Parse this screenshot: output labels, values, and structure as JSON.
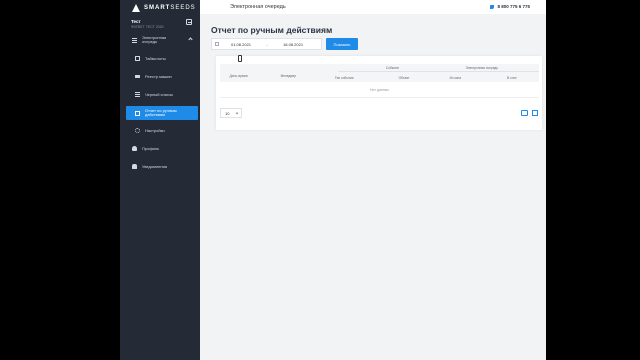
{
  "app": {
    "logo_text_bold": "SMART",
    "logo_text_light": "SEEDS"
  },
  "user": {
    "name": "Тест",
    "org": "ФХПВГТ ТЕСТ 2020"
  },
  "sidebar": {
    "items": [
      {
        "label": "Электронная очередь",
        "icon": "queue-icon"
      },
      {
        "label": "Таймслоты",
        "icon": "timeslot-icon"
      },
      {
        "label": "Реестр машин",
        "icon": "truck-icon"
      },
      {
        "label": "Черный список",
        "icon": "blacklist-icon"
      },
      {
        "label": "Отчет по ручным действиям",
        "icon": "report-icon"
      },
      {
        "label": "Настройки",
        "icon": "gear-icon"
      },
      {
        "label": "Профиль",
        "icon": "user-icon"
      },
      {
        "label": "Уведомления",
        "icon": "bell-icon"
      }
    ]
  },
  "header": {
    "title": "Электронная очередь",
    "phone": "8 800 775 6 775"
  },
  "page": {
    "title": "Отчет по ручным действиям"
  },
  "filters": {
    "date_from": "01.08.2021",
    "separator": "→",
    "date_to": "18.08.2021",
    "show_label": "Показать"
  },
  "table": {
    "groups": {
      "events": "Событие",
      "queue": "Электронная очередь"
    },
    "columns": [
      "Дата, время",
      "Менеджер",
      "Тип события",
      "Объект",
      "Из окна",
      "В слот"
    ],
    "empty_text": "Нет данных"
  },
  "pagination": {
    "page_size": "10"
  },
  "colors": {
    "accent": "#1f8be8",
    "sidebar": "#252b36"
  }
}
